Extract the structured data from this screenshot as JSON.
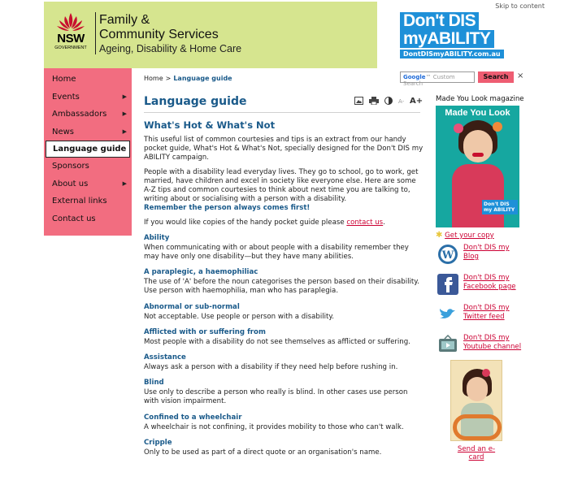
{
  "header": {
    "logo_name": "NSW",
    "logo_sub": "GOVERNMENT",
    "brand_line1": "Family &",
    "brand_line2": "Community Services",
    "brand_line3": "Ageing, Disability & Home Care",
    "skip_link": "Skip to content",
    "campaign_line1": "Don't DIS",
    "campaign_line2": "myABILITY",
    "campaign_url": "DontDISmyABILITY.com.au",
    "brand_color": "#d6e58f",
    "campaign_color": "#1e90d8"
  },
  "search": {
    "placeholder": "Custom Search",
    "button_label": "Search",
    "close_glyph": "×",
    "button_color": "#ee5d72"
  },
  "nav": {
    "background": "#f26d80",
    "items": [
      {
        "label": "Home",
        "has_submenu": false
      },
      {
        "label": "Events",
        "has_submenu": true
      },
      {
        "label": "Ambassadors",
        "has_submenu": true
      },
      {
        "label": "News",
        "has_submenu": true
      },
      {
        "label": "Language guide",
        "has_submenu": false,
        "current": true
      },
      {
        "label": "Sponsors",
        "has_submenu": false
      },
      {
        "label": "About us",
        "has_submenu": true
      },
      {
        "label": "External links",
        "has_submenu": false
      },
      {
        "label": "Contact us",
        "has_submenu": false
      }
    ],
    "chevron_glyph": "▶"
  },
  "breadcrumb": {
    "home": "Home",
    "separator": ">",
    "current": "Language guide"
  },
  "page": {
    "title": "Language guide",
    "tools": {
      "image_icon": "image-icon",
      "print_icon": "printer-icon",
      "contrast_icon": "contrast-icon",
      "font_smaller": "A-",
      "font_larger": "A+"
    },
    "heading": "What's Hot & What's Not",
    "intro": "This useful list of common courtesies and tips is an extract from our handy pocket guide, What's Hot & What's Not, specially designed for the Don't DIS my ABILITY campaign.",
    "para2": "People with a disability lead everyday lives. They go to school, go to work, get married, have children and excel in society like everyone else. Here are some A-Z tips and common courtesies to think about next time you are talking to, writing about or socialising with a person with a disability.",
    "remember": "Remember the person always comes first!",
    "copies_prefix": "If you would like copies of the handy pocket guide please ",
    "copies_link": "contact us",
    "copies_suffix": ".",
    "terms": [
      {
        "term": "Ability",
        "def": "When communicating with or about people with a disability remember they may have only one disability—but they have many abilities."
      },
      {
        "term": "A paraplegic, a haemophiliac",
        "def": "The use of 'A' before the noun categorises the person based on their disability. Use person with haemophilia, man who has paraplegia."
      },
      {
        "term": "Abnormal or sub-normal",
        "def": "Not acceptable. Use people or person with a disability."
      },
      {
        "term": "Afflicted with or suffering from",
        "def": "Most people with a disability do not see themselves as afflicted or suffering."
      },
      {
        "term": "Assistance",
        "def": "Always ask a person with a disability if they need help before rushing in."
      },
      {
        "term": "Blind",
        "def": "Use only to describe a person who really is blind. In other cases use person with vision impairment."
      },
      {
        "term": "Confined to a wheelchair",
        "def": "A wheelchair is not confining, it provides mobility to those who can't walk."
      },
      {
        "term": "Cripple",
        "def": "Only to be used as part of a direct quote or an organisation's name."
      }
    ]
  },
  "sidebar": {
    "magazine_heading": "Made You Look magazine",
    "magazine_cover_title": "Made You Look",
    "magazine_badge": "Don't DIS my ABILITY",
    "get_copy_label": "Get your copy",
    "social": [
      {
        "icon": "wordpress-icon",
        "label": "Don't DIS my Blog"
      },
      {
        "icon": "facebook-icon",
        "label": "Don't DIS my Facebook page"
      },
      {
        "icon": "twitter-icon",
        "label": "Don't DIS my Twitter feed"
      },
      {
        "icon": "youtube-icon",
        "label": "Don't DIS my Youtube channel"
      }
    ],
    "ecard_label": "Send an e-card"
  }
}
